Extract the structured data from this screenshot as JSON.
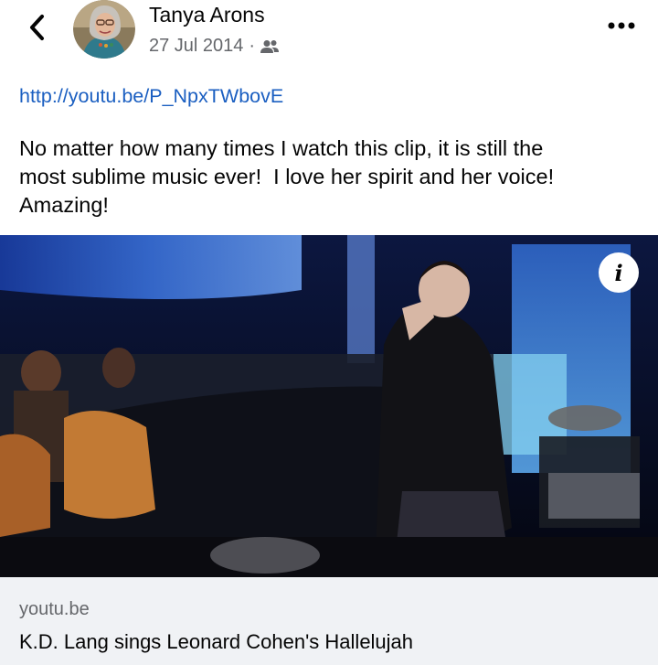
{
  "header": {
    "author_name": "Tanya Arons",
    "date": "27 Jul 2014",
    "separator": "·",
    "back_icon": "chevron-left-icon",
    "audience_icon": "friends-icon",
    "more_icon": "more-horizontal-icon"
  },
  "post": {
    "link_url": "http://youtu.be/P_NpxTWbovE",
    "text": "No matter how many times I watch this clip, it is still the\nmost sublime music ever!  I love her spirit and her voice!\nAmazing!"
  },
  "media": {
    "info_label": "i"
  },
  "link_preview": {
    "domain": "youtu.be",
    "title": "K.D. Lang sings Leonard Cohen's Hallelujah"
  },
  "colors": {
    "link": "#1b5fc1",
    "secondary_text": "#65676b",
    "card_background": "#f0f2f5"
  }
}
